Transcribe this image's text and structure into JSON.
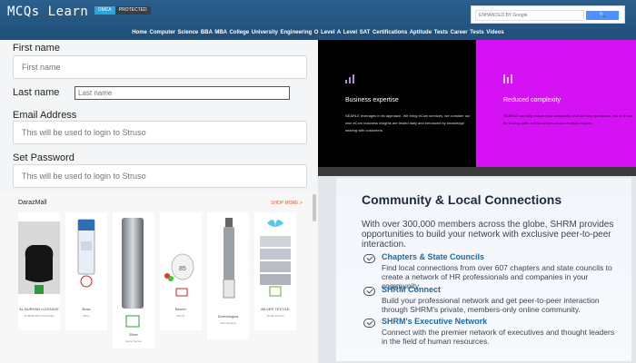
{
  "header": {
    "logo": "MCQs Learn",
    "badge_left": "DMCA",
    "badge_right": "PROTECTED",
    "search_placeholder": "ENHANCED BY Google",
    "search_button": "🔍",
    "nav_links": "Home Computer Science BBA MBA College University Engineering O Level A Level SAT Certifications Aptitude Tests Career Tests Videos"
  },
  "form": {
    "first_name_label": "First name",
    "first_name_placeholder": "First name",
    "last_name_label": "Last name",
    "last_name_placeholder": "Last name",
    "email_label": "Email Address",
    "email_placeholder": "This will be used to login to Struso",
    "password_label": "Set Password",
    "password_placeholder": "This will be used to login to Struso"
  },
  "business": {
    "left_title": "Business expertise",
    "left_text": "SEARLE leverages in its approach. We bring eCom services, we consider our own eCom business insights are tested daily and enhanced by knowledge sharing with customers.",
    "right_title": "Reduced complexity",
    "right_text": "SEARLE can help reduce your complexity of eCom key operations, risk and cost by sharing skills and know-how across multiple regions.",
    "icon_color": "#b38be0",
    "right_bg": "#d412f4"
  },
  "daraz": {
    "title": "DarazMall",
    "shop_more": "SHOP MORE >",
    "products": [
      {
        "name": "AL BURHAN LUGGAGE",
        "sub": "AL BURHAN LUGGAGE"
      },
      {
        "name": "Boss",
        "sub": "Boss"
      },
      {
        "name": "Zilver",
        "sub": "Home Secure"
      },
      {
        "name": "Beurer",
        "sub": "Beurer"
      },
      {
        "name": "Dermologica",
        "sub": "Dermologica"
      },
      {
        "name": "BILVER TEXTILE",
        "sub": "Textile Factory"
      }
    ]
  },
  "shrm": {
    "title": "Community & Local Connections",
    "intro": "With over 300,000 members across the globe, SHRM provides opportunities to build your network with exclusive peer-to-peer interaction.",
    "items": [
      {
        "title": "Chapters & State Councils",
        "text": "Find local connections from over 607 chapters and state councils to create a network of HR professionals and companies in your community."
      },
      {
        "title": "SHRM Connect",
        "text": "Build your professional network and get peer-to-peer interaction through SHRM's private, members-only online community."
      },
      {
        "title": "SHRM's Executive Network",
        "text": "Connect with the premier network of executives and thought leaders in the field of human resources."
      }
    ]
  }
}
